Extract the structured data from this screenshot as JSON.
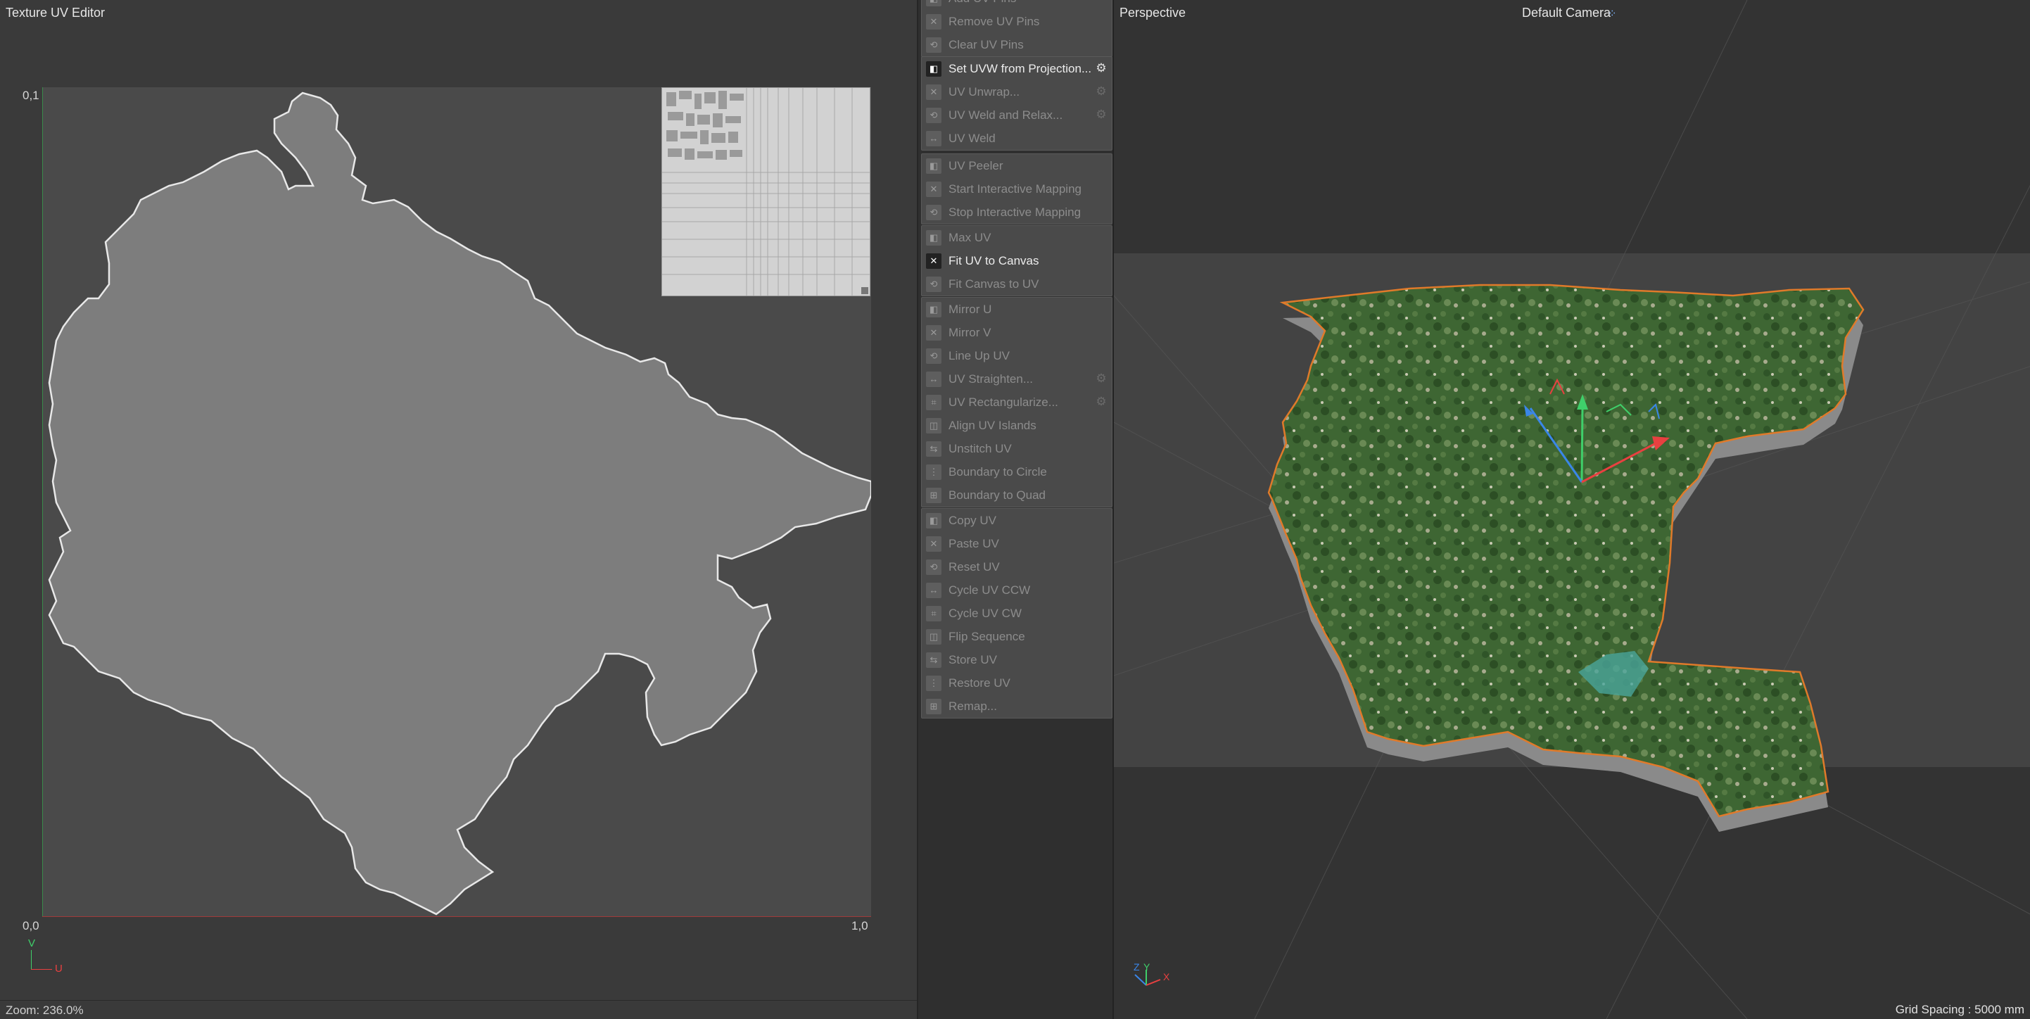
{
  "uv_editor": {
    "title": "Texture UV Editor",
    "axis_top_label": "0,1",
    "axis_origin_label": "0,0",
    "axis_right_label": "1,0",
    "axis_v": "V",
    "axis_u": "U",
    "zoom": "Zoom: 236.0%"
  },
  "commands": {
    "group1": [
      {
        "label": "Add UV Pins",
        "enabled": false
      },
      {
        "label": "Remove UV Pins",
        "enabled": false
      },
      {
        "label": "Clear UV Pins",
        "enabled": false
      }
    ],
    "group2": [
      {
        "label": "Set UVW from Projection...",
        "enabled": true,
        "gear": true
      },
      {
        "label": "UV Unwrap...",
        "enabled": false,
        "gear": true
      },
      {
        "label": "UV Weld and Relax...",
        "enabled": false,
        "gear": true
      },
      {
        "label": "UV Weld",
        "enabled": false
      }
    ],
    "group3": [
      {
        "label": "UV Peeler",
        "enabled": false
      },
      {
        "label": "Start Interactive Mapping",
        "enabled": false
      },
      {
        "label": "Stop Interactive Mapping",
        "enabled": false
      }
    ],
    "group4": [
      {
        "label": "Max UV",
        "enabled": false
      },
      {
        "label": "Fit UV to Canvas",
        "enabled": true
      },
      {
        "label": "Fit Canvas to UV",
        "enabled": false
      }
    ],
    "group5": [
      {
        "label": "Mirror U",
        "enabled": false
      },
      {
        "label": "Mirror V",
        "enabled": false
      },
      {
        "label": "Line Up UV",
        "enabled": false
      },
      {
        "label": "UV Straighten...",
        "enabled": false,
        "gear": true
      },
      {
        "label": "UV Rectangularize...",
        "enabled": false,
        "gear": true
      },
      {
        "label": "Align UV Islands",
        "enabled": false
      },
      {
        "label": "Unstitch UV",
        "enabled": false
      },
      {
        "label": "Boundary to Circle",
        "enabled": false
      },
      {
        "label": "Boundary to Quad",
        "enabled": false
      }
    ],
    "group6": [
      {
        "label": "Copy UV",
        "enabled": false
      },
      {
        "label": "Paste UV",
        "enabled": false
      },
      {
        "label": "Reset UV",
        "enabled": false
      },
      {
        "label": "Cycle UV CCW",
        "enabled": false
      },
      {
        "label": "Cycle UV CW",
        "enabled": false
      },
      {
        "label": "Flip Sequence",
        "enabled": false
      },
      {
        "label": "Store UV",
        "enabled": false
      },
      {
        "label": "Restore UV",
        "enabled": false
      },
      {
        "label": "Remap...",
        "enabled": false
      }
    ]
  },
  "viewport": {
    "title": "Perspective",
    "camera": "Default Camera",
    "grid_spacing": "Grid Spacing : 5000 mm",
    "axis_z": "Z",
    "axis_y": "Y",
    "axis_x": "X"
  },
  "colors": {
    "accent_orange": "#e07a2a",
    "terrain_green": "#3f6a34",
    "axis_red": "#e84040",
    "axis_green": "#3fcf6a",
    "axis_blue": "#3a86e8"
  }
}
